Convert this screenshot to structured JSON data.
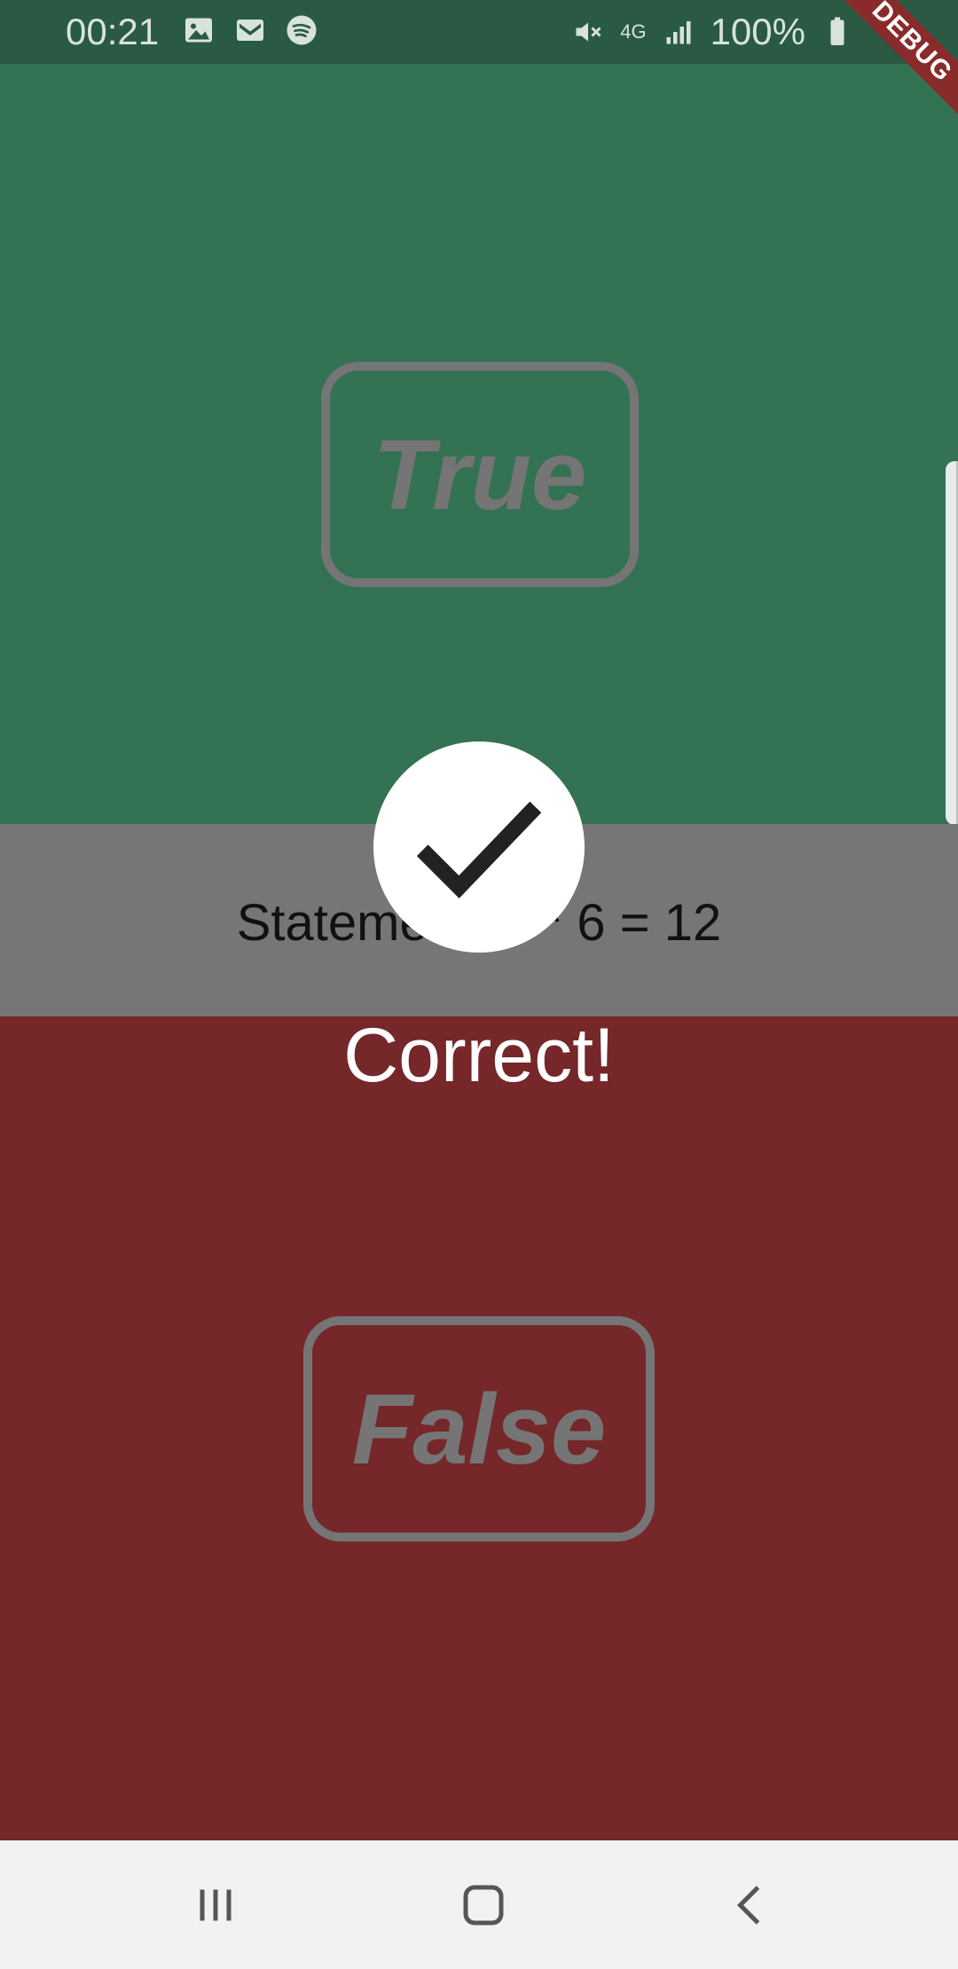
{
  "status_bar": {
    "time": "00:21",
    "battery": "100%",
    "network": "4G",
    "left_icons": [
      "gallery-icon",
      "gmail-icon",
      "spotify-icon"
    ],
    "right_icons": [
      "mute-icon",
      "4g-data-icon",
      "signal-icon",
      "battery-icon"
    ]
  },
  "debug_banner": "DEBUG",
  "buttons": {
    "true_label": "True",
    "false_label": "False"
  },
  "statement": {
    "text": "Statement: 2 * 6 = 12"
  },
  "feedback": {
    "icon": "checkmark-icon",
    "message": "Correct!"
  },
  "colors": {
    "true_bg": "#337252",
    "false_bg": "#752729",
    "statement_bg": "#767676",
    "button_border": "#757575"
  },
  "nav": {
    "icons": [
      "recents-icon",
      "home-icon",
      "back-icon"
    ]
  }
}
